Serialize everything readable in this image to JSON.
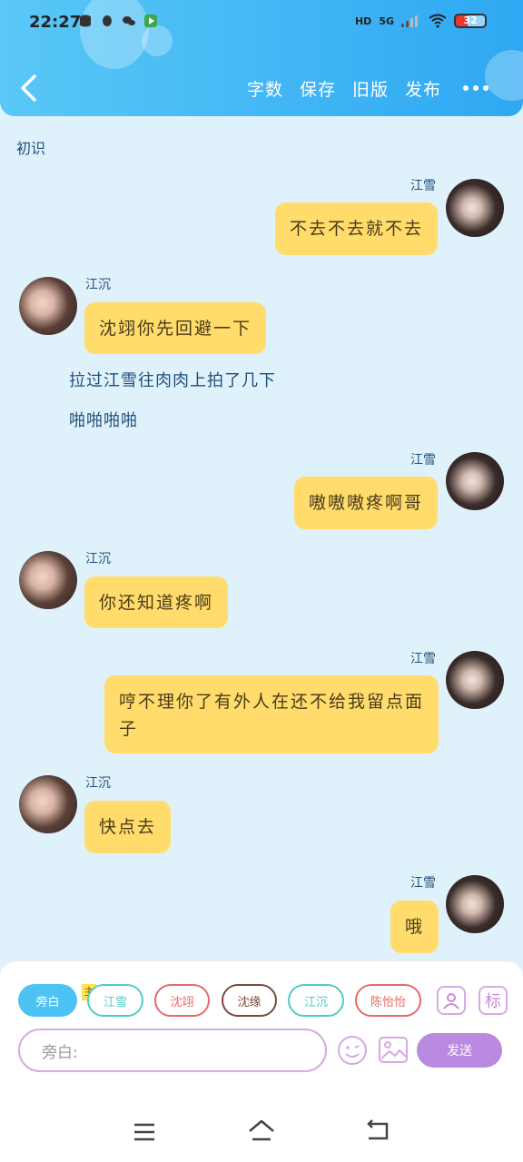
{
  "status_bar": {
    "time": "22:27",
    "signal": "5G",
    "hd": "HD",
    "battery": "32"
  },
  "header": {
    "actions": [
      "字数",
      "保存",
      "旧版",
      "发布"
    ]
  },
  "chat": {
    "title": "初识",
    "messages": [
      {
        "speaker": "江雪",
        "side": "right",
        "text": "不去不去就不去"
      },
      {
        "speaker": "江沉",
        "side": "left",
        "text": "沈翊你先回避一下"
      },
      {
        "speaker": "",
        "side": "narration",
        "text": "拉过江雪往肉肉上拍了几下"
      },
      {
        "speaker": "",
        "side": "narration",
        "text": "啪啪啪啪"
      },
      {
        "speaker": "江雪",
        "side": "right",
        "text": "嗷嗷嗷疼啊哥"
      },
      {
        "speaker": "江沉",
        "side": "left",
        "text": "你还知道疼啊"
      },
      {
        "speaker": "江雪",
        "side": "right",
        "text": "哼不理你了有外人在还不给我留点面子"
      },
      {
        "speaker": "江沉",
        "side": "left",
        "text": "快点去"
      },
      {
        "speaker": "江雪",
        "side": "right",
        "text": "哦"
      }
    ]
  },
  "roles": {
    "main_badge": "主",
    "items": [
      {
        "label": "旁白",
        "color": "#4cc3f2"
      },
      {
        "label": "江雪",
        "color": "#4ecdc4"
      },
      {
        "label": "沈翊",
        "color": "#e86a6a"
      },
      {
        "label": "沈缘",
        "color": "#7a4a3a"
      },
      {
        "label": "江沉",
        "color": "#4ecdc4"
      },
      {
        "label": "陈怡怡",
        "color": "#e86a6a"
      }
    ],
    "tag_icon_text": "标"
  },
  "composer": {
    "placeholder": "旁白:",
    "send_label": "发送"
  },
  "colors": {
    "header": "#42b6f5",
    "bubble": "#ffdc6b",
    "background": "#dff2fb",
    "send": "#b98ae0"
  }
}
